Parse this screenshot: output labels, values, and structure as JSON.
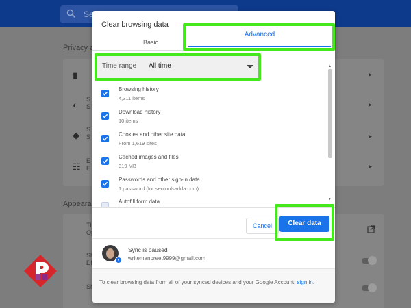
{
  "background": {
    "search_placeholder": "Se",
    "privacy_heading": "Privacy an",
    "appearance_heading": "Appeara",
    "rows": [
      {
        "line1": "",
        "line2": ""
      },
      {
        "line1": "S",
        "line2": "S"
      },
      {
        "line1": "S",
        "line2": "S"
      },
      {
        "line1": "E",
        "line2": "E"
      }
    ],
    "appearance_rows": [
      {
        "line1": "Theme",
        "line2": "Open C"
      },
      {
        "line1": "Show h",
        "line2": "Disable"
      },
      {
        "line1": "Show b",
        "line2": ""
      }
    ]
  },
  "dialog": {
    "title": "Clear browsing data",
    "tabs": [
      {
        "label": "Basic",
        "active": false
      },
      {
        "label": "Advanced",
        "active": true
      }
    ],
    "time_range": {
      "label": "Time range",
      "value": "All time"
    },
    "items": [
      {
        "title": "Browsing history",
        "subtitle": "4,311 items",
        "checked": true
      },
      {
        "title": "Download history",
        "subtitle": "10 items",
        "checked": true
      },
      {
        "title": "Cookies and other site data",
        "subtitle": "From 1,619 sites",
        "checked": true
      },
      {
        "title": "Cached images and files",
        "subtitle": "319 MB",
        "checked": true
      },
      {
        "title": "Passwords and other sign-in data",
        "subtitle": "1 password (for seotoolsadda.com)",
        "checked": true
      },
      {
        "title": "Autofill form data",
        "subtitle": "",
        "checked": false
      }
    ],
    "buttons": {
      "cancel": "Cancel",
      "clear": "Clear data"
    },
    "sync": {
      "title": "Sync is paused",
      "email": "writemanpreet9999@gmail.com"
    },
    "note": {
      "text": "To clear browsing data from all of your synced devices and your Google Account, ",
      "link": "sign in."
    }
  },
  "colors": {
    "accent": "#1a73e8",
    "highlight": "#44e81d",
    "topbar": "#0e3a8c",
    "logo_red": "#d7262b"
  },
  "icons": [
    "search-icon",
    "trash-icon",
    "cookie-icon",
    "shield-icon",
    "settings-icon",
    "external-link-icon",
    "check-icon",
    "dropdown-caret-icon"
  ]
}
